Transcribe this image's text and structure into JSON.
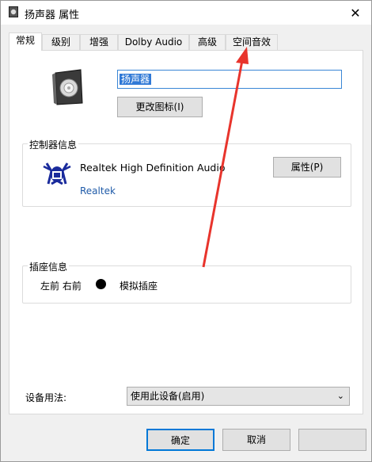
{
  "window": {
    "title": "扬声器 属性",
    "close_glyph": "✕"
  },
  "tabs": [
    {
      "label": "常规",
      "active": true
    },
    {
      "label": "级别",
      "active": false
    },
    {
      "label": "增强",
      "active": false
    },
    {
      "label": "Dolby Audio",
      "active": false
    },
    {
      "label": "高级",
      "active": false
    },
    {
      "label": "空间音效",
      "active": false
    }
  ],
  "general": {
    "device_name": "扬声器",
    "change_icon_label": "更改图标(I)"
  },
  "controller": {
    "group_title": "控制器信息",
    "name": "Realtek High Definition Audio",
    "vendor": "Realtek",
    "properties_label": "属性(P)"
  },
  "jack": {
    "group_title": "插座信息",
    "position": "左前 右前",
    "type": "模拟插座"
  },
  "usage": {
    "label": "设备用法:",
    "selected": "使用此设备(启用)"
  },
  "buttons": {
    "ok": "确定",
    "cancel": "取消",
    "apply": ""
  },
  "colors": {
    "accent": "#0078d7",
    "annotation_arrow": "#e8342c",
    "vendor_link": "#1e5aa8"
  },
  "icons": {
    "title": "speaker-icon",
    "device": "speaker-device-icon",
    "controller": "realtek-logo-icon",
    "dropdown": "chevron-down-icon"
  }
}
